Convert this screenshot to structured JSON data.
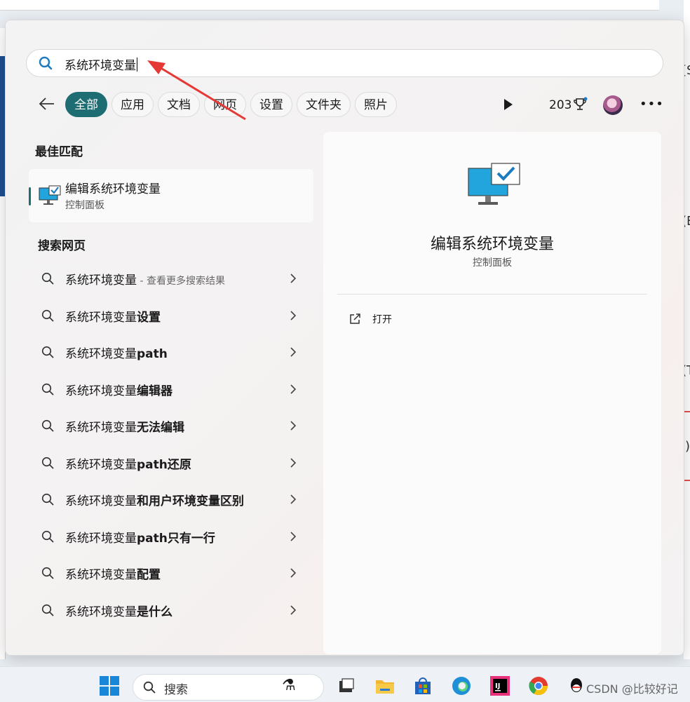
{
  "search": {
    "query": "系统环境变量"
  },
  "filters": [
    "全部",
    "应用",
    "文档",
    "网页",
    "设置",
    "文件夹",
    "照片"
  ],
  "rewards_points": "203",
  "best_match": {
    "heading": "最佳匹配",
    "title": "编辑系统环境变量",
    "subtitle": "控制面板"
  },
  "web_search": {
    "heading": "搜索网页",
    "first": {
      "base": "系统环境变量",
      "hint": " - 查看更多搜索结果"
    },
    "items": [
      {
        "base": "系统环境变量",
        "suffix": "设置"
      },
      {
        "base": "系统环境变量",
        "suffix": "path"
      },
      {
        "base": "系统环境变量",
        "suffix": "编辑器"
      },
      {
        "base": "系统环境变量",
        "suffix": "无法编辑"
      },
      {
        "base": "系统环境变量",
        "suffix": "path还原"
      },
      {
        "base": "系统环境变量",
        "suffix": "和用户环境变量区别"
      },
      {
        "base": "系统环境变量",
        "suffix": "path只有一行"
      },
      {
        "base": "系统环境变量",
        "suffix": "配置"
      },
      {
        "base": "系统环境变量",
        "suffix": "是什么"
      }
    ]
  },
  "detail": {
    "title": "编辑系统环境变量",
    "subtitle": "控制面板",
    "action_open": "打开"
  },
  "taskbar": {
    "search_placeholder": "搜索"
  },
  "watermark": "CSDN @比较好记",
  "colors": {
    "accent": "#1e6d73",
    "arrow": "#e53935"
  },
  "icons": [
    "search-icon",
    "back-arrow-icon",
    "play-icon",
    "trophy-icon",
    "more-icon",
    "monitor-check-icon",
    "chevron-right-icon",
    "open-external-icon",
    "windows-logo-icon"
  ]
}
